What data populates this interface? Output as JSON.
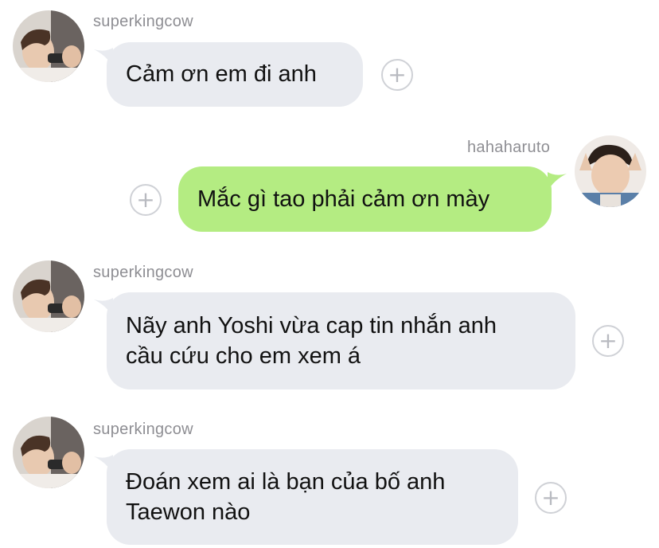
{
  "messages": [
    {
      "sender": "superkingcow",
      "text": "Cảm ơn em đi anh"
    },
    {
      "sender": "hahaharuto",
      "text": "Mắc gì tao phải cảm ơn mày"
    },
    {
      "sender": "superkingcow",
      "lines": [
        "Nãy anh Yoshi vừa cap tin nhắn anh",
        "cầu cứu cho em xem á"
      ]
    },
    {
      "sender": "superkingcow",
      "lines": [
        "Đoán xem ai là bạn của bố anh",
        "Taewon nào"
      ]
    }
  ],
  "icons": {
    "add": "plus-circle-icon",
    "avatar": "user-avatar-photo"
  },
  "colors": {
    "incoming_bubble": "#e9ebf0",
    "outgoing_bubble": "#b4ec82",
    "username_text": "#8e8e93",
    "add_icon": "#b8bac0"
  }
}
